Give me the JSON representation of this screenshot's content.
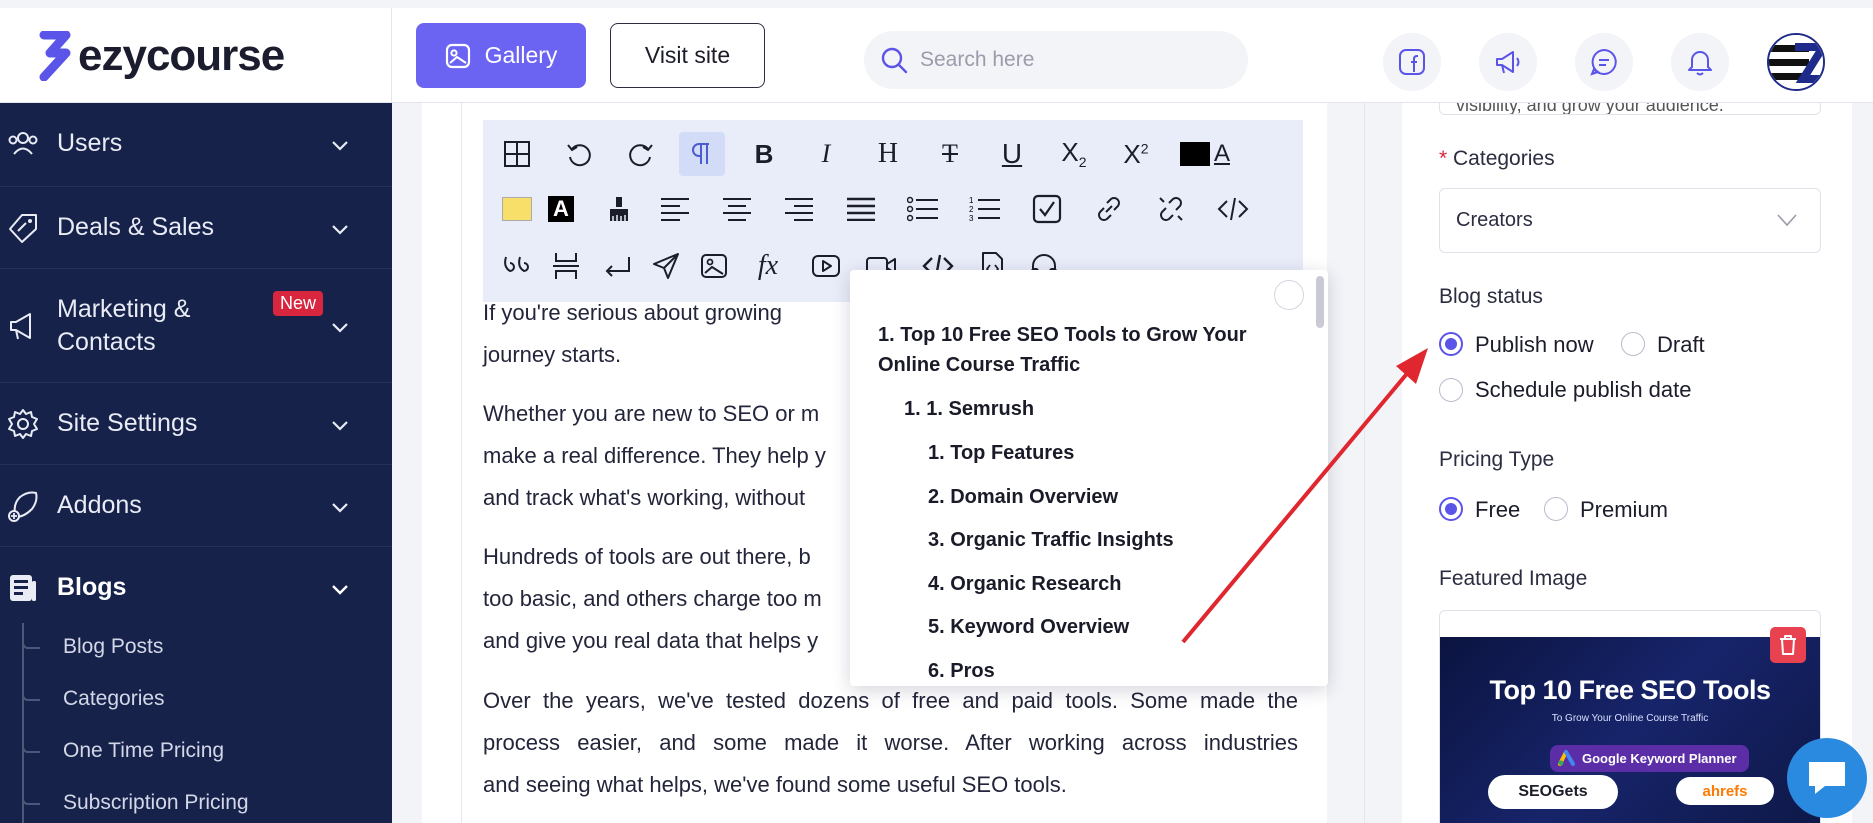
{
  "brand": {
    "name": "ezycourse"
  },
  "header": {
    "gallery_label": "Gallery",
    "visit_label": "Visit site",
    "search_placeholder": "Search here"
  },
  "sidebar": {
    "items": [
      {
        "label": "Users"
      },
      {
        "label": "Deals & Sales"
      },
      {
        "label": "Marketing & Contacts",
        "line1": "Marketing &",
        "line2": "Contacts",
        "badge": "New"
      },
      {
        "label": "Site Settings"
      },
      {
        "label": "Addons"
      },
      {
        "label": "Blogs"
      }
    ],
    "blog_subitems": [
      "Blog Posts",
      "Categories",
      "One Time Pricing",
      "Subscription Pricing"
    ]
  },
  "editor": {
    "paragraphs": [
      {
        "l1": "If you're serious about growing",
        "l2": "journey starts."
      },
      {
        "l1": "Whether you are new to SEO or m",
        "l2": "make a real difference. They help y",
        "l3": "and track what's working, without"
      },
      {
        "l1": "Hundreds of tools are out there, b",
        "l2": "too basic, and others charge too m",
        "l3": "and give you real data that helps y"
      },
      {
        "l1": "Over the years, we've tested dozens of free and paid tools. Some made the",
        "l2": "process easier, and some made it worse. After working across industries",
        "l3": "and seeing what helps, we've found some useful SEO tools."
      }
    ]
  },
  "toc": {
    "items": [
      "1. Top 10 Free SEO Tools to Grow Your",
      "Online Course Traffic",
      "1. 1. Semrush",
      "1. Top Features",
      "2. Domain Overview",
      "3. Organic Traffic Insights",
      "4. Organic Research",
      "5. Keyword Overview",
      "6. Pros"
    ]
  },
  "right_panel": {
    "top_clip_text": "visibility, and grow your audience.",
    "categories_label": "Categories",
    "categories_value": "Creators",
    "blog_status_label": "Blog status",
    "status_options": [
      "Publish now",
      "Draft",
      "Schedule publish date"
    ],
    "status_selected": "Publish now",
    "pricing_label": "Pricing Type",
    "pricing_options": [
      "Free",
      "Premium"
    ],
    "pricing_selected": "Free",
    "featured_label": "Featured Image",
    "featured_title": "Top 10 Free SEO Tools",
    "featured_sub": "To Grow Your Online Course Traffic",
    "featured_chip": "Google Keyword Planner",
    "featured_logo1": "SEOGets",
    "featured_logo2": "ahrefs"
  },
  "colors": {
    "sidebar_bg": "#16224a",
    "accent": "#6b63f2",
    "annotation_arrow": "#e0262e"
  }
}
